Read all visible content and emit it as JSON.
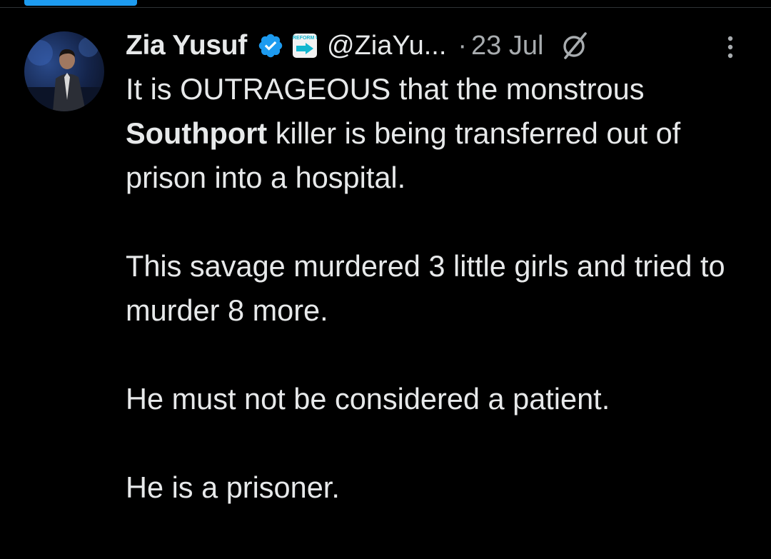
{
  "author": {
    "display_name": "Zia Yusuf",
    "handle": "@ZiaYu...",
    "affiliate_label": "REFORM UK",
    "verified_color": "#1d9bf0"
  },
  "meta": {
    "separator": "·",
    "date": "23 Jul"
  },
  "icons": {
    "verified": "verified-badge-icon",
    "affiliate": "reform-uk-affiliate-icon",
    "grok": "grok-icon",
    "more": "more-options-icon"
  },
  "tweet": {
    "p1_a": "It is OUTRAGEOUS that the monstrous ",
    "p1_bold": "Southport",
    "p1_b": " killer is being transferred out of prison into a hospital.",
    "p2": "This savage murdered 3 little girls and tried to murder 8 more.",
    "p3": "He must not be considered a patient.",
    "p4": "He is a prisoner."
  },
  "colors": {
    "background": "#000000",
    "text": "#e7e9ea",
    "secondary_text": "#a8acaf",
    "accent": "#1d9bf0"
  }
}
